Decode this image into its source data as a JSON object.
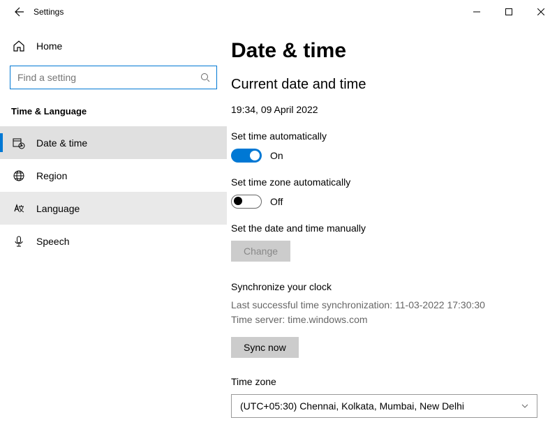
{
  "titlebar": {
    "title": "Settings"
  },
  "sidebar": {
    "home": "Home",
    "search_placeholder": "Find a setting",
    "category": "Time & Language",
    "items": [
      {
        "label": "Date & time"
      },
      {
        "label": "Region"
      },
      {
        "label": "Language"
      },
      {
        "label": "Speech"
      }
    ]
  },
  "content": {
    "heading": "Date & time",
    "subheading": "Current date and time",
    "datetime": "19:34, 09 April 2022",
    "auto_time_label": "Set time automatically",
    "auto_time_state": "On",
    "auto_tz_label": "Set time zone automatically",
    "auto_tz_state": "Off",
    "manual_label": "Set the date and time manually",
    "change_btn": "Change",
    "sync_heading": "Synchronize your clock",
    "sync_last": "Last successful time synchronization: 11-03-2022 17:30:30",
    "sync_server": "Time server: time.windows.com",
    "sync_btn": "Sync now",
    "tz_label": "Time zone",
    "tz_value": "(UTC+05:30) Chennai, Kolkata, Mumbai, New Delhi"
  }
}
